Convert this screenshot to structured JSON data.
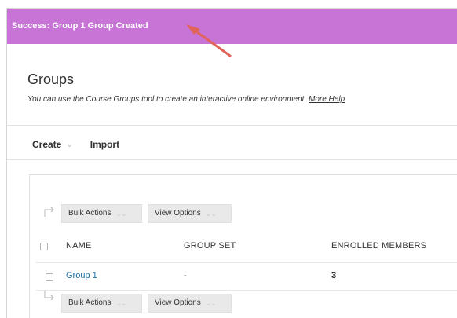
{
  "banner": {
    "message": "Success: Group 1 Group Created",
    "color": "#c774d6"
  },
  "annotation": {
    "arrow_color": "#e1645a"
  },
  "page": {
    "title": "Groups",
    "subtitle": "You can use the Course Groups tool to create an interactive online environment.",
    "help_link": "More Help"
  },
  "actions": {
    "create_label": "Create",
    "import_label": "Import"
  },
  "toolbar_top": {
    "bulk_actions": "Bulk Actions",
    "view_options": "View Options"
  },
  "toolbar_bottom": {
    "bulk_actions": "Bulk Actions",
    "view_options": "View Options"
  },
  "table": {
    "columns": [
      "NAME",
      "GROUP SET",
      "ENROLLED MEMBERS"
    ],
    "rows": [
      {
        "name": "Group 1",
        "group_set": "-",
        "enrolled_members": "3"
      }
    ]
  },
  "icons": {
    "create_chevron": "chevron-down-icon",
    "double_chevron": "double-chevron-down-icon",
    "connector": "bracket-arrow-icon"
  }
}
